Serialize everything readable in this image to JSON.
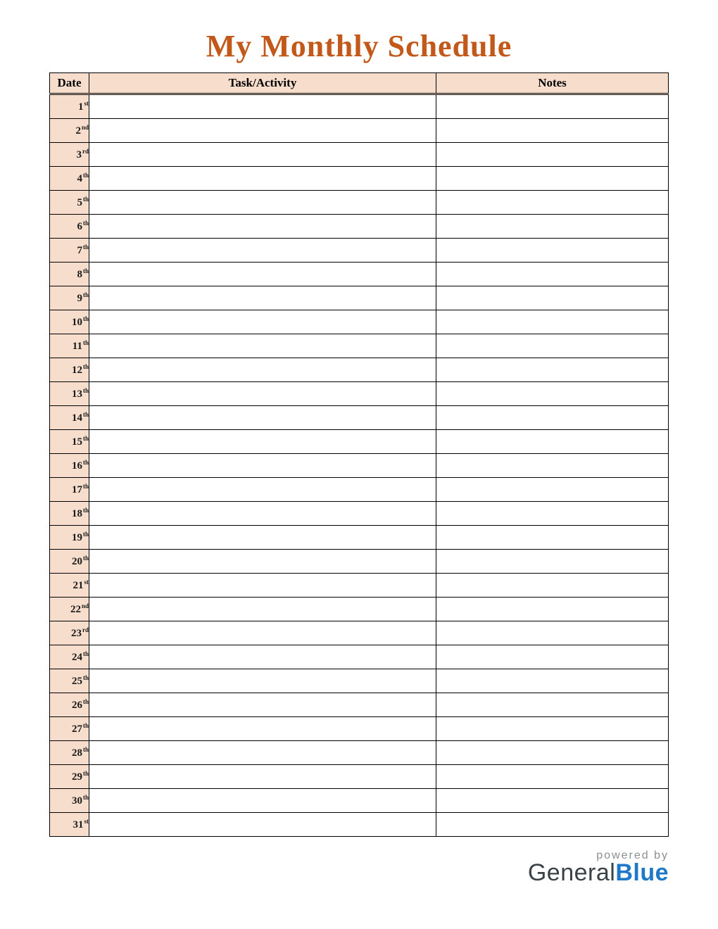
{
  "title": "My Monthly Schedule",
  "columns": {
    "date": "Date",
    "task": "Task/Activity",
    "notes": "Notes"
  },
  "rows": [
    {
      "num": "1",
      "ord": "st",
      "task": "",
      "notes": ""
    },
    {
      "num": "2",
      "ord": "nd",
      "task": "",
      "notes": ""
    },
    {
      "num": "3",
      "ord": "rd",
      "task": "",
      "notes": ""
    },
    {
      "num": "4",
      "ord": "th",
      "task": "",
      "notes": ""
    },
    {
      "num": "5",
      "ord": "th",
      "task": "",
      "notes": ""
    },
    {
      "num": "6",
      "ord": "th",
      "task": "",
      "notes": ""
    },
    {
      "num": "7",
      "ord": "th",
      "task": "",
      "notes": ""
    },
    {
      "num": "8",
      "ord": "th",
      "task": "",
      "notes": ""
    },
    {
      "num": "9",
      "ord": "th",
      "task": "",
      "notes": ""
    },
    {
      "num": "10",
      "ord": "th",
      "task": "",
      "notes": ""
    },
    {
      "num": "11",
      "ord": "th",
      "task": "",
      "notes": ""
    },
    {
      "num": "12",
      "ord": "th",
      "task": "",
      "notes": ""
    },
    {
      "num": "13",
      "ord": "th",
      "task": "",
      "notes": ""
    },
    {
      "num": "14",
      "ord": "th",
      "task": "",
      "notes": ""
    },
    {
      "num": "15",
      "ord": "th",
      "task": "",
      "notes": ""
    },
    {
      "num": "16",
      "ord": "th",
      "task": "",
      "notes": ""
    },
    {
      "num": "17",
      "ord": "th",
      "task": "",
      "notes": ""
    },
    {
      "num": "18",
      "ord": "th",
      "task": "",
      "notes": ""
    },
    {
      "num": "19",
      "ord": "th",
      "task": "",
      "notes": ""
    },
    {
      "num": "20",
      "ord": "th",
      "task": "",
      "notes": ""
    },
    {
      "num": "21",
      "ord": "st",
      "task": "",
      "notes": ""
    },
    {
      "num": "22",
      "ord": "nd",
      "task": "",
      "notes": ""
    },
    {
      "num": "23",
      "ord": "rd",
      "task": "",
      "notes": ""
    },
    {
      "num": "24",
      "ord": "th",
      "task": "",
      "notes": ""
    },
    {
      "num": "25",
      "ord": "th",
      "task": "",
      "notes": ""
    },
    {
      "num": "26",
      "ord": "th",
      "task": "",
      "notes": ""
    },
    {
      "num": "27",
      "ord": "th",
      "task": "",
      "notes": ""
    },
    {
      "num": "28",
      "ord": "th",
      "task": "",
      "notes": ""
    },
    {
      "num": "29",
      "ord": "th",
      "task": "",
      "notes": ""
    },
    {
      "num": "30",
      "ord": "th",
      "task": "",
      "notes": ""
    },
    {
      "num": "31",
      "ord": "st",
      "task": "",
      "notes": ""
    }
  ],
  "footer": {
    "powered": "powered by",
    "brand1": "General",
    "brand2": "Blue"
  }
}
